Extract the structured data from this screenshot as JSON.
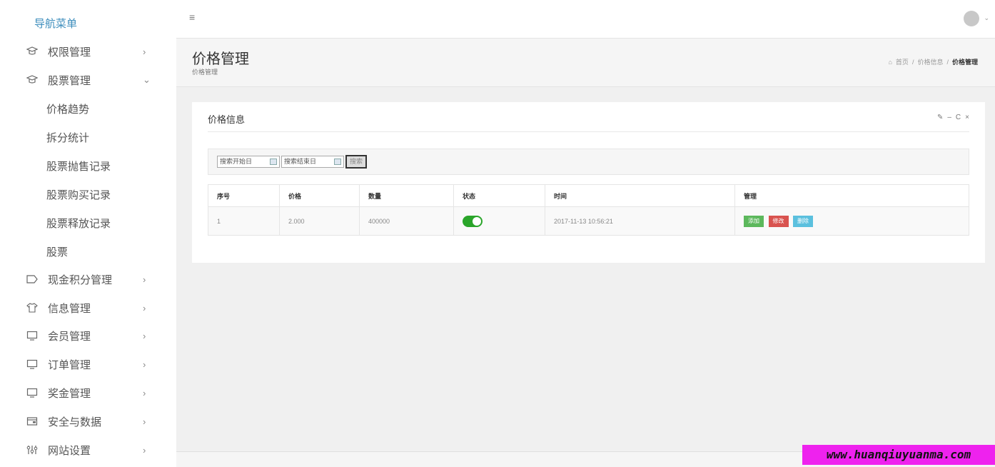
{
  "sidebar": {
    "title": "导航菜单",
    "items": [
      {
        "label": "权限管理",
        "icon": "graduation-cap-icon",
        "arrow": "›"
      },
      {
        "label": "股票管理",
        "icon": "graduation-cap-icon",
        "arrow": "⌄"
      },
      {
        "label": "现金积分管理",
        "icon": "tag-icon",
        "arrow": "›"
      },
      {
        "label": "信息管理",
        "icon": "shirt-icon",
        "arrow": "›"
      },
      {
        "label": "会员管理",
        "icon": "monitor-icon",
        "arrow": "›"
      },
      {
        "label": "订单管理",
        "icon": "monitor-icon",
        "arrow": "›"
      },
      {
        "label": "奖金管理",
        "icon": "monitor-icon",
        "arrow": "›"
      },
      {
        "label": "安全与数据",
        "icon": "wallet-icon",
        "arrow": "›"
      },
      {
        "label": "网站设置",
        "icon": "sliders-icon",
        "arrow": "›"
      }
    ],
    "subitems": [
      "价格趋势",
      "拆分统计",
      "股票抛售记录",
      "股票购买记录",
      "股票释放记录",
      "股票"
    ]
  },
  "topbar": {
    "menu_icon": "≡"
  },
  "header": {
    "title": "价格管理",
    "subtitle": "价格管理",
    "breadcrumb": {
      "home": "首页",
      "sep": "/",
      "mid": "价格信息",
      "current": "价格管理"
    }
  },
  "card": {
    "title": "价格信息",
    "tools": [
      "✎",
      "–",
      "C",
      "×"
    ]
  },
  "search": {
    "start_placeholder": "搜索开始日",
    "end_placeholder": "搜索结束日",
    "button": "搜索"
  },
  "table": {
    "headers": [
      "序号",
      "价格",
      "数量",
      "状态",
      "时间",
      "管理"
    ],
    "rows": [
      {
        "id": "1",
        "price": "2.000",
        "qty": "400000",
        "status": "on",
        "time": "2017-11-13 10:56:21"
      }
    ],
    "actions": {
      "add": "添加",
      "edit": "修改",
      "delete": "删除"
    }
  },
  "colors": {
    "accent": "#3c8dbc",
    "toggle": "#2aa52a",
    "add": "#5cb85c",
    "edit": "#d9534f",
    "delete": "#5bc0de"
  },
  "watermark": "www.huanqiuyuanma.com"
}
